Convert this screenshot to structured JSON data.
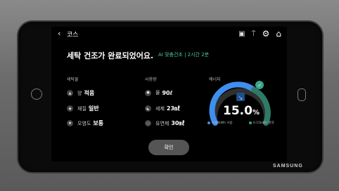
{
  "header": {
    "back_icon": "chevron-left-icon",
    "title": "코스"
  },
  "status": {
    "message": "세탁 건조가 완료되었어요.",
    "note": "AI 맞춤건조 | 2시간 2분"
  },
  "wash": {
    "title": "세탁물",
    "items": [
      {
        "icon": "load-icon",
        "label": "양",
        "value": "적음"
      },
      {
        "icon": "fabric-icon",
        "label": "재질",
        "value": "일반"
      },
      {
        "icon": "soil-icon",
        "label": "오염도",
        "value": "보통"
      }
    ]
  },
  "usage": {
    "title": "사용량",
    "items": [
      {
        "icon": "water-icon",
        "label": "물",
        "value": "90ℓ"
      },
      {
        "icon": "detergent-icon",
        "label": "세제",
        "value": "23㎖"
      },
      {
        "icon": "softener-icon",
        "label": "유연제",
        "value": "30㎖"
      }
    ]
  },
  "energy": {
    "title": "에너지",
    "value": "15.0",
    "unit": "%",
    "used_label": "0.89kWh 사용",
    "saved_label": "0.15kWh 절약",
    "colors": {
      "used": "#3f8ff0",
      "saved": "#3aa58a"
    }
  },
  "confirm_label": "확인",
  "brand": "SAMSUNG"
}
